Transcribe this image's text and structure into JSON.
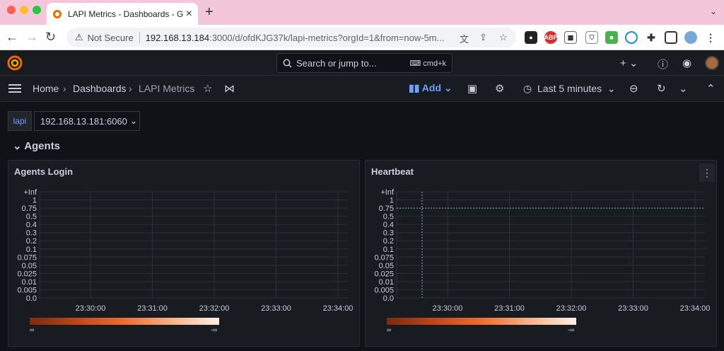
{
  "browser": {
    "tab_title": "LAPI Metrics - Dashboards - Gr",
    "security_label": "Not Secure",
    "url_host": "192.168.13.184",
    "url_rest": ":3000/d/ofdKJG37k/lapi-metrics?orgId=1&from=now-5m..."
  },
  "grafana": {
    "search_placeholder": "Search or jump to...",
    "search_shortcut": "cmd+k",
    "breadcrumbs": [
      "Home",
      "Dashboards",
      "LAPI Metrics"
    ],
    "add_label": "Add",
    "time_range": "Last 5 minutes"
  },
  "variables": {
    "label": "lapi",
    "value": "192.168.13.181:6060"
  },
  "row": {
    "title": "Agents"
  },
  "panels": [
    {
      "title": "Agents Login",
      "y_ticks": [
        "+Inf",
        "1",
        "0.75",
        "0.5",
        "0.4",
        "0.3",
        "0.2",
        "0.1",
        "0.075",
        "0.05",
        "0.025",
        "0.01",
        "0.005",
        "0.0"
      ],
      "x_ticks": [
        "23:30:00",
        "23:31:00",
        "23:32:00",
        "23:33:00",
        "23:34:00"
      ],
      "legend_min": "∞",
      "legend_max": "-∞"
    },
    {
      "title": "Heartbeat",
      "y_ticks": [
        "+Inf",
        "1",
        "0.75",
        "0.5",
        "0.4",
        "0.3",
        "0.2",
        "0.1",
        "0.075",
        "0.05",
        "0.025",
        "0.01",
        "0.005",
        "0.0"
      ],
      "x_ticks": [
        "23:30:00",
        "23:31:00",
        "23:32:00",
        "23:33:00",
        "23:34:00"
      ],
      "legend_min": "∞",
      "legend_max": "-∞",
      "annotation_level": "0.75"
    }
  ],
  "colors": {
    "accent": "#6e9fff",
    "bg": "#111217",
    "panel": "#181b1f"
  }
}
